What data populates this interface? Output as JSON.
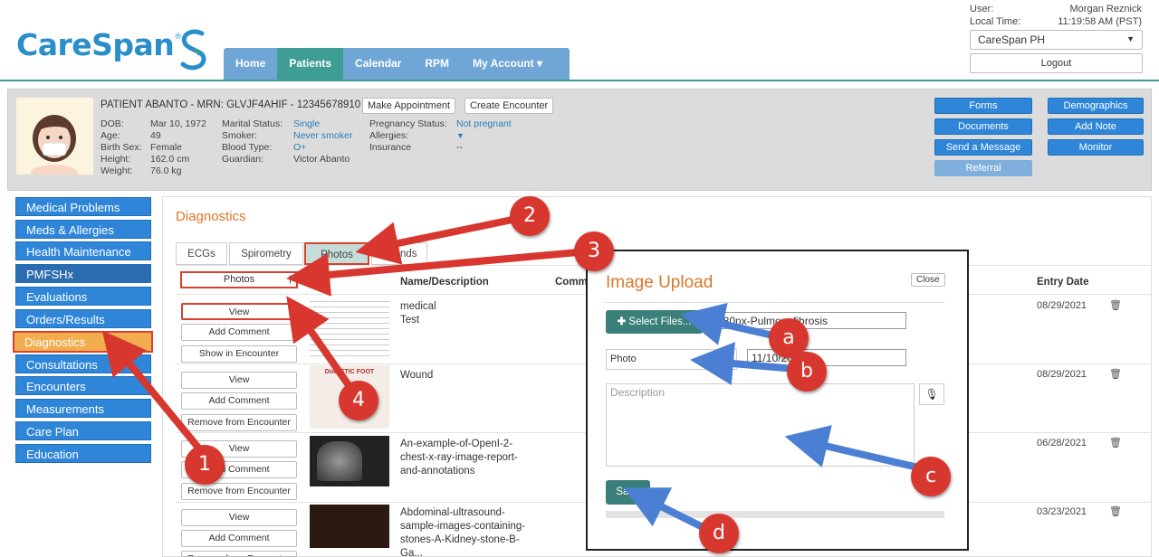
{
  "app": {
    "brand": "CareSpan",
    "brand_mark": "®"
  },
  "nav": {
    "items": [
      "Home",
      "Patients",
      "Calendar",
      "RPM",
      "My Account ▾"
    ],
    "active": "Patients"
  },
  "user": {
    "user_label": "User:",
    "user_name": "Morgan Reznick",
    "time_label": "Local Time:",
    "time_value": "11:19:58 AM (PST)",
    "org": "CareSpan PH",
    "logout": "Logout"
  },
  "patient": {
    "title": "PATIENT ABANTO - MRN: GLVJF4AHIF - 12345678910",
    "make_appt": "Make Appointment",
    "create_enc": "Create Encounter",
    "col1": {
      "labels": [
        "DOB:",
        "Age:",
        "Birth Sex:",
        "Height:",
        "Weight:"
      ],
      "values": [
        "Mar 10, 1972",
        "49",
        "Female",
        "162.0 cm",
        "76.0 kg"
      ]
    },
    "col2": {
      "labels": [
        "Marital Status:",
        "Smoker:",
        "Blood Type:",
        "Guardian:"
      ],
      "values": [
        "Single",
        "Never smoker",
        "O+",
        "Victor Abanto"
      ]
    },
    "col3": {
      "labels": [
        "Pregnancy Status:",
        "Allergies:",
        "Insurance"
      ],
      "values": [
        "Not pregnant",
        "▼",
        "--"
      ]
    }
  },
  "actions": {
    "forms": "Forms",
    "demographics": "Demographics",
    "documents": "Documents",
    "add_note": "Add Note",
    "send_message": "Send a Message",
    "monitor": "Monitor",
    "referral": "Referral"
  },
  "sidebar": {
    "items": [
      "Medical Problems",
      "Meds & Allergies",
      "Health Maintenance",
      "PMFSHx",
      "Evaluations",
      "Orders/Results",
      "Diagnostics",
      "Consultations",
      "Encounters",
      "Measurements",
      "Care Plan",
      "Education"
    ]
  },
  "main": {
    "title": "Diagnostics",
    "tabs": [
      "ECGs",
      "Spirometry",
      "Photos",
      "Sounds"
    ],
    "photos_col": "Photos",
    "col_name": "Name/Description",
    "col_comm": "Comm",
    "col_date": "Entry Date",
    "rows": [
      {
        "buttons": [
          "View",
          "Add Comment",
          "Show in Encounter"
        ],
        "name": "medical",
        "desc": "Test",
        "date": "08/29/2021"
      },
      {
        "buttons": [
          "View",
          "Add Comment",
          "Remove from Encounter"
        ],
        "name": "Wound",
        "desc": "",
        "date": "08/29/2021"
      },
      {
        "buttons": [
          "View",
          "Add Comment",
          "Remove from Encounter"
        ],
        "name": "An-example-of-OpenI-2-",
        "desc": "chest-x-ray-image-report-",
        "desc2": "and-annotations",
        "date": "06/28/2021"
      },
      {
        "buttons": [
          "View",
          "Add Comment",
          "Remove from Encounter"
        ],
        "name": "Abdominal-ultrasound-",
        "desc": "sample-images-containing-",
        "desc2": "stones-A-Kidney-stone-B-",
        "desc3": "Ga...",
        "date": "03/23/2021"
      }
    ]
  },
  "modal": {
    "title": "Image Upload",
    "close": "Close",
    "select_files": "Select Files...",
    "file_name": "280px-Pulmon_fibrosis",
    "type": "Photo",
    "date": "11/10/2021",
    "description_placeholder": "Description",
    "save": "Save"
  },
  "callouts": {
    "n1": "1",
    "n2": "2",
    "n3": "3",
    "n4": "4",
    "a": "a",
    "b": "b",
    "c": "c",
    "d": "d"
  },
  "thumb_text": {
    "wound": "DIABETIC FOOT"
  },
  "colors": {
    "accent": "#2f86d8",
    "teal": "#3e9e96",
    "orange": "#d9772b",
    "red": "#d7372e",
    "arrow_blue": "#4a7fd4"
  }
}
